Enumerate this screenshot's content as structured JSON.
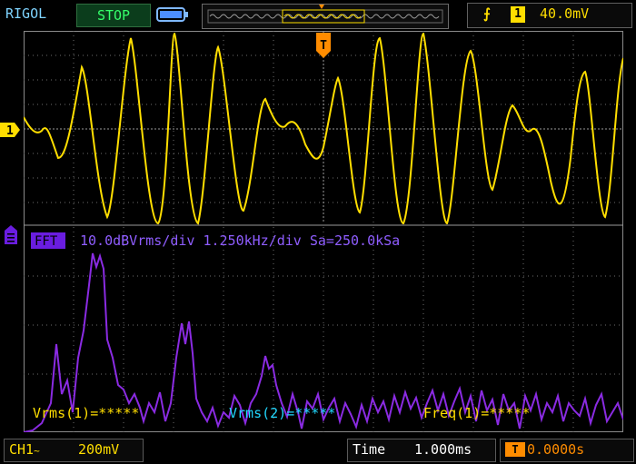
{
  "header": {
    "brand": "RIGOL",
    "status": "STOP",
    "trigger_edge_symbol": "⨍",
    "trigger_channel": "1",
    "trigger_level": "40.0mV",
    "trigger_marker": "T"
  },
  "ch1_marker": "1",
  "fft": {
    "tag": "FFT",
    "info": "10.0dBVrms/div 1.250kHz/div Sa=250.0kSa"
  },
  "measurements": [
    {
      "label": "Vrms(1)=*****",
      "color": "#ffde00"
    },
    {
      "label": "Vrms(2)=*****",
      "color": "#21d8ff"
    },
    {
      "label": "Freq(1)=*****",
      "color": "#ffde00"
    }
  ],
  "footer": {
    "channel": "CH1",
    "coupling_icon": "~",
    "volts_div": "200mV",
    "time_label": "Time",
    "time_value": "1.000ms",
    "offset_icon": "T",
    "offset_value": "0.0000s"
  },
  "colors": {
    "ch1": "#ffde00",
    "fft": "#8a2be2",
    "fft_text": "#8f5dff",
    "grid": "#8a8a8a",
    "trigger": "#ff8c00",
    "status_bg": "#0b3d1c"
  },
  "icons": [
    "battery-icon",
    "trigger-edge-icon",
    "trigger-marker-icon",
    "memory-depth-icon",
    "ch1-ground-marker",
    "fft-channel-marker-icon"
  ]
}
